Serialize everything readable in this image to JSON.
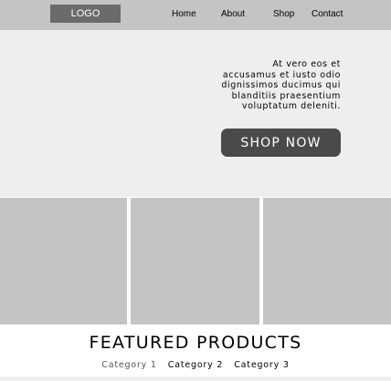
{
  "header": {
    "logo": "LOGO",
    "nav": [
      "Home",
      "About",
      "Shop",
      "Contact"
    ]
  },
  "hero": {
    "text": "At vero eos et accusamus et iusto odio dignissimos ducimus qui blanditiis praesentium voluptatum deleniti.",
    "cta_label": "SHOP NOW"
  },
  "featured": {
    "title": "FEATURED PRODUCTS",
    "categories": [
      "Category 1",
      "Category 2",
      "Category 3"
    ]
  },
  "colors": {
    "header_bg": "#c4c4c4",
    "logo_bg": "#6b6b6b",
    "hero_bg": "#eeeeee",
    "button_bg": "#4a4a4a",
    "tile_bg": "#c4c4c4"
  }
}
